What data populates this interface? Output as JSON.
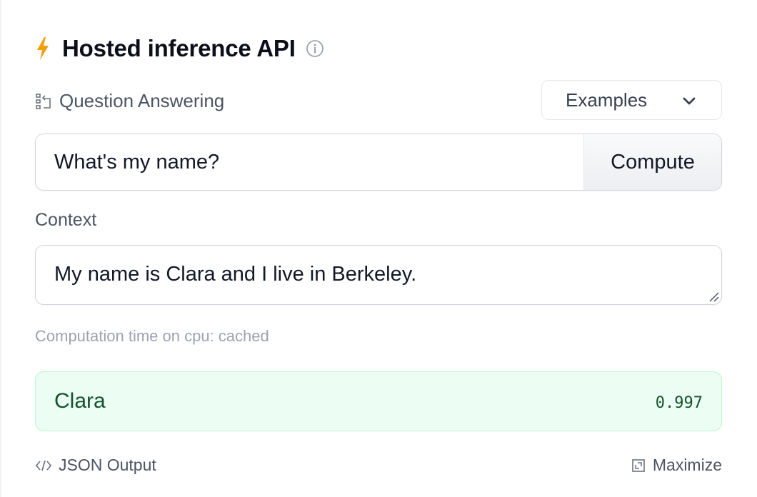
{
  "header": {
    "title": "Hosted inference API",
    "icon": "lightning-bolt-icon",
    "info_icon": "info-icon",
    "accent_color": "#f59e0b"
  },
  "task": {
    "label": "Question Answering",
    "icon": "question-answering-icon"
  },
  "examples": {
    "label": "Examples"
  },
  "question": {
    "value": "What's my name?"
  },
  "compute": {
    "label": "Compute"
  },
  "context": {
    "label": "Context",
    "value": "My name is Clara and I live in Berkeley."
  },
  "computation": {
    "text": "Computation time on cpu: cached"
  },
  "answer": {
    "text": "Clara",
    "score": "0.997",
    "bg_color": "#ecfdf3",
    "text_color": "#14532d"
  },
  "footer": {
    "json_label": "JSON Output",
    "maximize_label": "Maximize"
  }
}
